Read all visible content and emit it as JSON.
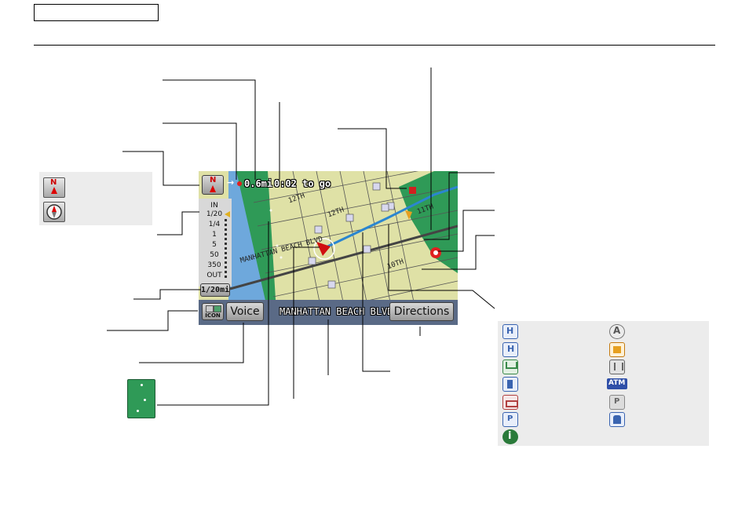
{
  "screen": {
    "compass": {
      "north_letter": "N"
    },
    "trip": {
      "distance": "0.6mi",
      "time_to_go": "0:02 to go"
    },
    "scale_bar": {
      "in_label": "IN",
      "out_label": "OUT",
      "levels": [
        "1/20",
        "1/4",
        "1",
        "5",
        "50",
        "350"
      ],
      "current_level": "1/20"
    },
    "scale_readout": "1/20mi",
    "icon_button_label": "ICON",
    "voice_button": "Voice",
    "street_name": "MANHATTAN BEACH BLVD",
    "directions_button": "Directions",
    "map_labels": [
      "MANHATTAN BEACH BLVD",
      "12TH",
      "12TH",
      "11TH",
      "10TH"
    ]
  },
  "legend_north": {
    "north_letter": "N"
  },
  "poi_icons": {
    "left_column": [
      "honda-dealer-icon",
      "hospital-icon",
      "shopping-cart-icon",
      "gas-station-icon",
      "hotel-bed-icon",
      "parking-garage-icon",
      "information-icon"
    ],
    "right_column": [
      "acura-dealer-icon",
      "school-icon",
      "restaurant-icon",
      "atm-icon",
      "parking-lot-icon",
      "bus-station-icon"
    ],
    "atm_text": "ATM",
    "hospital_letter": "H",
    "parking_letter": "P",
    "info_letter": "i"
  },
  "colors": {
    "map_land": "#dfe1a6",
    "park_green": "#2f9a57",
    "water_blue": "#6ea8dc",
    "route_blue": "#2b86d0",
    "screen_frame": "#5a6a86"
  }
}
